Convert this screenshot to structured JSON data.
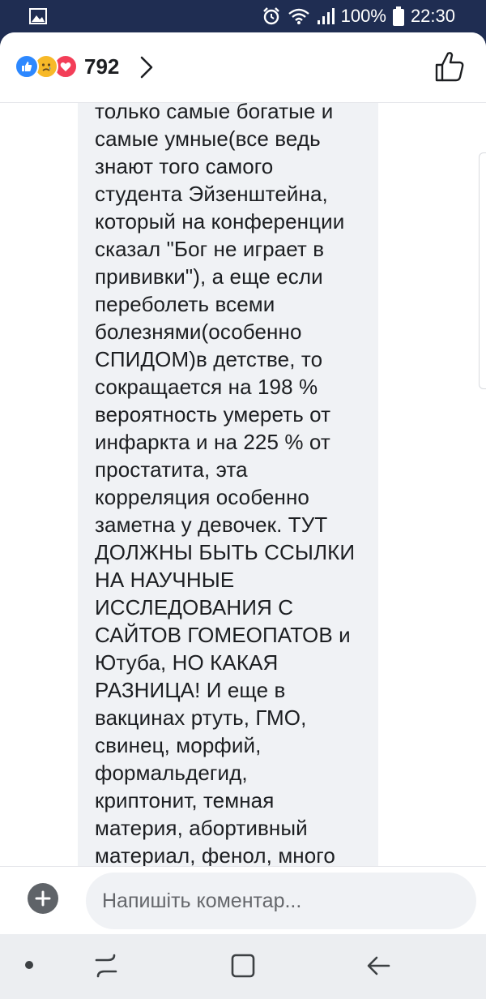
{
  "status_bar": {
    "battery": "100%",
    "time": "22:30",
    "icons": [
      "gallery-icon",
      "alarm-icon",
      "wifi-icon",
      "signal-icon",
      "battery-icon"
    ]
  },
  "header": {
    "reactions": [
      "like-icon",
      "sad-icon",
      "love-icon"
    ],
    "reaction_count": "792"
  },
  "comment": {
    "text": "только самые богатые и\nсамые умные(все ведь\nзнают того самого\nстудента Эйзенштейна,\nкоторый на конференции\nсказал \"Бог не играет в\nпрививки\"), а еще если\nпереболеть всеми\nболезнями(особенно\nСПИДОМ)в детстве, то\nсокращается на 198 %\nвероятность умереть от\nинфаркта и на 225 % от\nпростатита, эта\nкорреляция особенно\nзаметна у девочек. ТУТ\nДОЛЖНЫ БЫТЬ ССЫЛКИ\nНА НАУЧНЫЕ\nИССЛЕДОВАНИЯ С\nСАЙТОВ ГОМЕОПАТОВ и\nЮтуба, НО КАКАЯ\nРАЗНИЦА! И еще в\nвакцинах ртуть, ГМО,\nсвинец, морфий,\nформальдегид,\nкриптонит, темная\nматерия, абортивный\nматериал, фенол, много"
  },
  "composer": {
    "placeholder": "Напишіть коментар..."
  },
  "nav_bar": {
    "buttons": [
      "dot-icon",
      "recent-apps-icon",
      "home-icon",
      "back-icon"
    ]
  },
  "colors": {
    "status_bar_bg": "#1f2d52",
    "like_blue": "#2d88ff",
    "sad_yellow": "#f7b928",
    "love_red": "#f33e58",
    "bubble_bg": "#f0f2f5"
  }
}
